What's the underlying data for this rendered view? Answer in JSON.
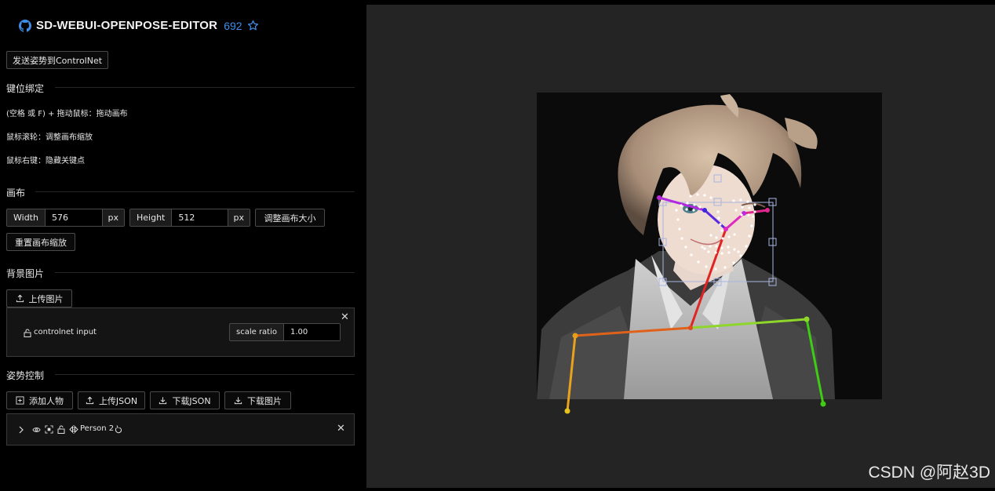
{
  "header": {
    "title": "SD-WEBUI-OPENPOSE-EDITOR",
    "stars": "692"
  },
  "send_button": "发送姿势到ControlNet",
  "keybindings": {
    "title": "键位绑定",
    "items": [
      "(空格 或 F) + 拖动鼠标：拖动画布",
      "鼠标滚轮：调整画布缩放",
      "鼠标右键：隐藏关键点"
    ]
  },
  "canvas": {
    "title": "画布",
    "width_label": "Width",
    "width_value": "576",
    "width_unit": "px",
    "height_label": "Height",
    "height_value": "512",
    "height_unit": "px",
    "resize_button": "调整画布大小",
    "reset_zoom_button": "重置画布缩放"
  },
  "background": {
    "title": "背景图片",
    "upload_button": "上传图片",
    "layer_name": "controlnet input",
    "scale_label": "scale ratio",
    "scale_value": "1.00"
  },
  "pose": {
    "title": "姿势控制",
    "add_person": "添加人物",
    "upload_json": "上传JSON",
    "download_json": "下载JSON",
    "download_image": "下载图片",
    "person_name": "Person 2"
  },
  "watermark": "CSDN @阿赵3D",
  "colors": {
    "accent": "#3e8ee8",
    "panel_bg": "#141414",
    "canvas_bg": "#242424"
  }
}
